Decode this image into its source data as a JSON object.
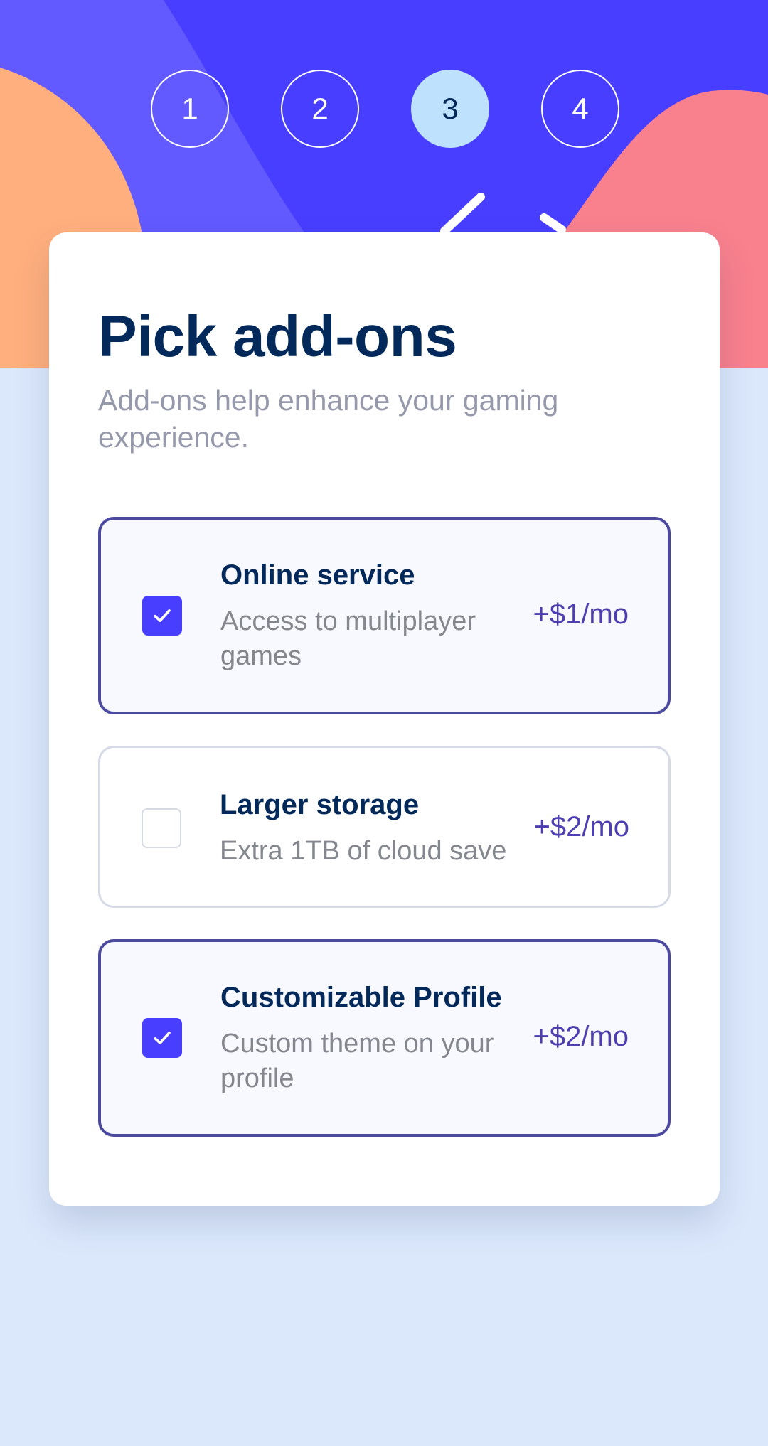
{
  "colors": {
    "hero_background": "#483eff",
    "hero_shape_purple": "#6259ff",
    "hero_shape_orange": "#ffaf7e",
    "hero_shape_pink": "#f9818e",
    "page_background": "#dbe8fc",
    "heading": "#02295a",
    "muted_text": "#9699ab",
    "accent": "#483eff",
    "active_step": "#bee2fd"
  },
  "steps": [
    {
      "number": "1",
      "active": false
    },
    {
      "number": "2",
      "active": false
    },
    {
      "number": "3",
      "active": true
    },
    {
      "number": "4",
      "active": false
    }
  ],
  "page": {
    "title": "Pick add-ons",
    "subtitle": "Add-ons help enhance your gaming experience."
  },
  "addons": [
    {
      "name": "Online service",
      "description": "Access to multiplayer games",
      "price": "+$1/mo",
      "checked": true,
      "icon": "checkmark-icon"
    },
    {
      "name": "Larger storage",
      "description": "Extra 1TB of cloud save",
      "price": "+$2/mo",
      "checked": false,
      "icon": "checkmark-icon"
    },
    {
      "name": "Customizable Profile",
      "description": "Custom theme on your profile",
      "price": "+$2/mo",
      "checked": true,
      "icon": "checkmark-icon"
    }
  ]
}
